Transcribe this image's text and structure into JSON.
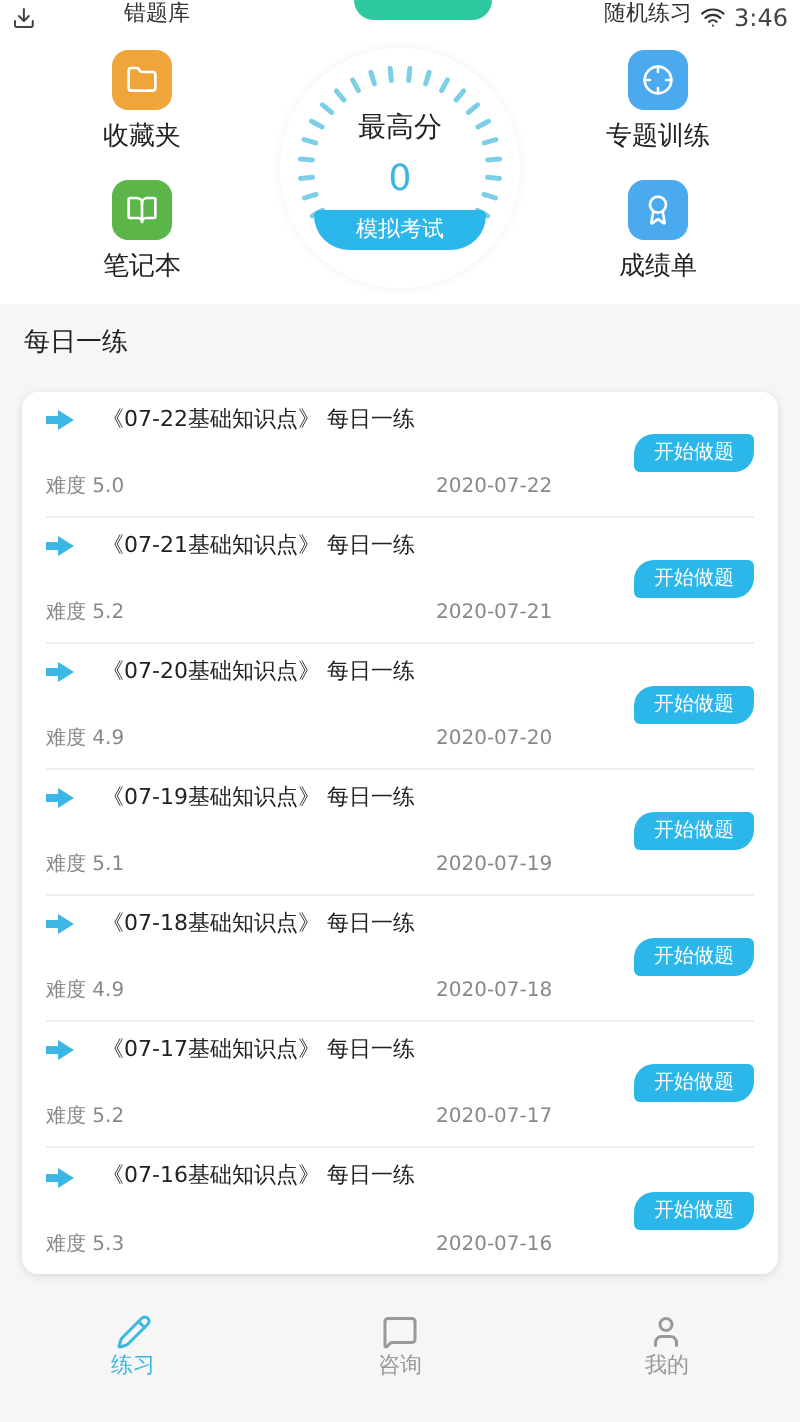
{
  "status_bar": {
    "time": "3:46"
  },
  "top_cut": {
    "left_label": "错题库",
    "right_label": "随机练习"
  },
  "left_shortcuts": [
    {
      "label": "收藏夹",
      "color": "#f0a53a"
    },
    {
      "label": "笔记本",
      "color": "#5bb548"
    }
  ],
  "right_shortcuts": [
    {
      "label": "专题训练",
      "color": "#4aa9ef"
    },
    {
      "label": "成绩单",
      "color": "#4aa9ef"
    }
  ],
  "gauge": {
    "title": "最高分",
    "score": "0",
    "button": "模拟考试"
  },
  "section_title": "每日一练",
  "exercises": [
    {
      "title": "《07-22基础知识点》 每日一练",
      "difficulty": "难度 5.0",
      "date": "2020-07-22",
      "button": "开始做题"
    },
    {
      "title": "《07-21基础知识点》 每日一练",
      "difficulty": "难度 5.2",
      "date": "2020-07-21",
      "button": "开始做题"
    },
    {
      "title": "《07-20基础知识点》 每日一练",
      "difficulty": "难度 4.9",
      "date": "2020-07-20",
      "button": "开始做题"
    },
    {
      "title": "《07-19基础知识点》 每日一练",
      "difficulty": "难度 5.1",
      "date": "2020-07-19",
      "button": "开始做题"
    },
    {
      "title": "《07-18基础知识点》 每日一练",
      "difficulty": "难度 4.9",
      "date": "2020-07-18",
      "button": "开始做题"
    },
    {
      "title": "《07-17基础知识点》 每日一练",
      "difficulty": "难度 5.2",
      "date": "2020-07-17",
      "button": "开始做题"
    },
    {
      "title": "《07-16基础知识点》 每日一练",
      "difficulty": "难度 5.3",
      "date": "2020-07-16",
      "button": "开始做题"
    }
  ],
  "tabs": [
    {
      "label": "练习",
      "selected": true
    },
    {
      "label": "咨询",
      "selected": false
    },
    {
      "label": "我的",
      "selected": false
    }
  ]
}
